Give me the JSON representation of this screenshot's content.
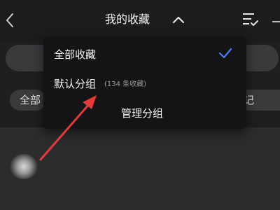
{
  "header": {
    "title": "我的收藏",
    "icons": [
      "back-icon",
      "chevron-up-icon",
      "sort-list-icon"
    ]
  },
  "filters": {
    "all_chip": "全部",
    "note_chip": "记"
  },
  "dropdown": {
    "items": [
      {
        "label": "全部收藏",
        "selected": true
      },
      {
        "label": "默认分组",
        "count": "(134 条收藏)",
        "selected": false
      }
    ],
    "manage_label": "管理分组"
  },
  "colors": {
    "accent": "#4b7bf5",
    "annotation_arrow": "#e33a3a"
  }
}
